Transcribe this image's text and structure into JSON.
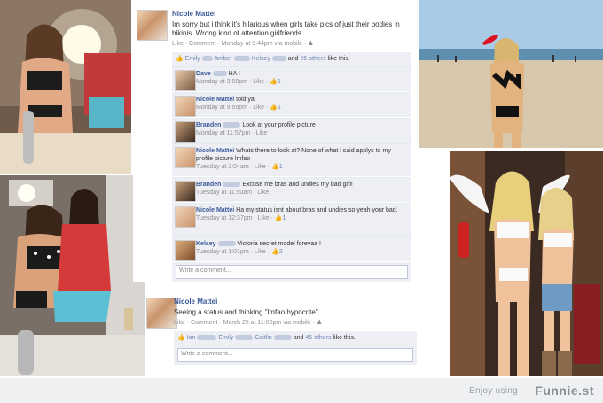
{
  "post1": {
    "author": "Nicole Mattei",
    "text": "Im sorry but i think it's hilarious when girls take pics of just their bodies in bikinis. Wrong kind of attention girlfriends.",
    "actions": "Like · Comment · Monday at 9:44pm via mobile ·",
    "likes": {
      "names_before": "Emily",
      "name2": "Amber",
      "name3": "Kelsey",
      "and_text": "and",
      "others_link": "26 others",
      "suffix": "like this."
    },
    "comments": [
      {
        "name": "Dave",
        "text": "HA !",
        "meta": "Monday at 9:58pm · Like ·",
        "likes": "1"
      },
      {
        "name": "Nicole Mattei",
        "text": "told ya!",
        "meta": "Monday at 9:59pm · Like ·",
        "likes": "1"
      },
      {
        "name": "Branden",
        "text": "Look at your profile picture",
        "meta": "Monday at 11:57pm · Like",
        "likes": ""
      },
      {
        "name": "Nicole Mattei",
        "text": "Whats there to look at? None of what i said applys to my profile picture lmfao",
        "meta": "Tuesday at 2:04am · Like ·",
        "likes": "1"
      },
      {
        "name": "Branden",
        "text": "Excuse me bras and undies my bad girl!",
        "meta": "Tuesday at 11:50am · Like",
        "likes": ""
      },
      {
        "name": "Nicole Mattei",
        "text": "Ha my status isnt about bras and undies so yeah your bad.",
        "meta": "Tuesday at 12:37pm · Like ·",
        "likes": "1"
      },
      {
        "name": "Kelsey",
        "text": "Victoria secret model forevaa !",
        "meta": "Tuesday at 1:01pm · Like ·",
        "likes": "2"
      }
    ],
    "write_placeholder": "Write a comment..."
  },
  "post2": {
    "author": "Nicole Mattei",
    "text": "Seeing a status and thinking \"lmfao hypocrite\"",
    "actions": "Like · Comment · March 25 at 11:00pm via mobile ·",
    "likes": {
      "names_before": "Ian",
      "name2": "Emily",
      "name3": "Caitlin",
      "and_text": "and",
      "others_link": "45 others",
      "suffix": "like this."
    },
    "write_placeholder": "Write a comment..."
  },
  "footer": {
    "enjoy": "Enjoy using",
    "brand": "Funnie.st"
  },
  "colors": {
    "fb_blue": "#3b5998",
    "link": "#6d84b4",
    "comment_bg": "#edeff4"
  }
}
